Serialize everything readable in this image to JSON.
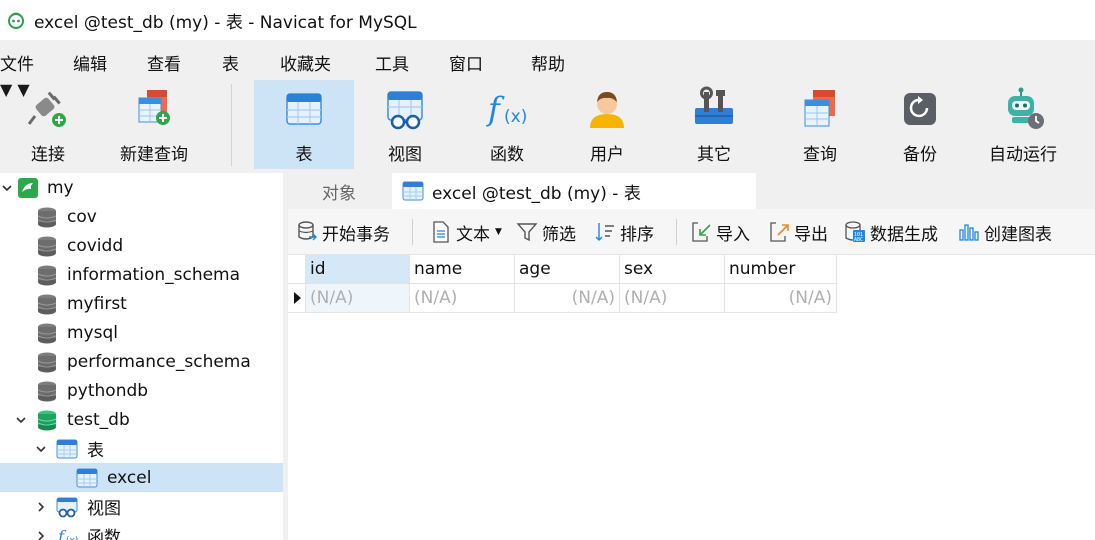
{
  "window": {
    "title": "excel @test_db (my) - 表 - Navicat for MySQL"
  },
  "menu": [
    "文件",
    "编辑",
    "查看",
    "表",
    "收藏夹",
    "工具",
    "窗口",
    "帮助"
  ],
  "toolbar": {
    "connect": "连接",
    "new_query": "新建查询",
    "table": "表",
    "view": "视图",
    "function": "函数",
    "user": "用户",
    "other": "其它",
    "query": "查询",
    "backup": "备份",
    "automation": "自动运行"
  },
  "tree": {
    "connection": "my",
    "databases": [
      "cov",
      "covidd",
      "information_schema",
      "myfirst",
      "mysql",
      "performance_schema",
      "pythondb"
    ],
    "open_db": "test_db",
    "tables_node": "表",
    "table_item": "excel",
    "views_node": "视图",
    "functions_node": "函数"
  },
  "tabs": {
    "objects": "对象",
    "current": "excel @test_db (my) - 表"
  },
  "object_toolbar": {
    "begin_transaction": "开始事务",
    "text": "文本",
    "filter": "筛选",
    "sort": "排序",
    "import": "导入",
    "export": "导出",
    "data_generation": "数据生成",
    "create_chart": "创建图表"
  },
  "grid": {
    "columns": [
      "id",
      "name",
      "age",
      "sex",
      "number"
    ],
    "row": [
      "(N/A)",
      "(N/A)",
      "(N/A)",
      "(N/A)",
      "(N/A)"
    ]
  },
  "colors": {
    "accent": "#1e88e5",
    "selection": "#cde4f7",
    "toolbar_bg": "#f0f0f0",
    "db_green": "#1ea362"
  }
}
